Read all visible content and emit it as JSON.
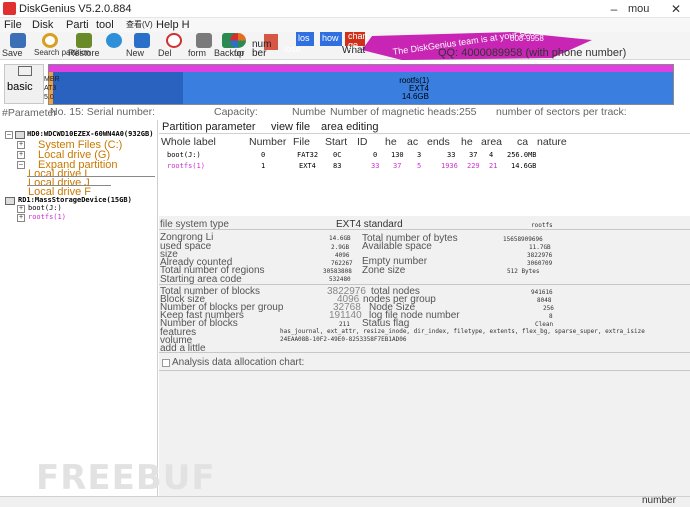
{
  "window": {
    "title": "DiskGenius V5.2.0.884",
    "corner_text": "mou",
    "minimize": "–",
    "maximize": "□",
    "close": "✕"
  },
  "menu": {
    "items": [
      {
        "label": "File"
      },
      {
        "label": "Disk"
      },
      {
        "label": "Parti"
      },
      {
        "label": "tool"
      },
      {
        "label": "查看(V)"
      },
      {
        "label": "Help H"
      }
    ]
  },
  "toolbar": {
    "buttons": [
      {
        "label": "Save",
        "icon": "save-icon",
        "color": "#3b6fb6"
      },
      {
        "label": "Search partition",
        "icon": "search-icon",
        "color": "#d8a020"
      },
      {
        "label": "Restore",
        "icon": "restore-icon",
        "color": "#6a8a2a"
      },
      {
        "label": "",
        "icon": "globe-icon",
        "color": "#2f8fd8"
      },
      {
        "label": "New",
        "icon": "new-icon",
        "color": "#2a70c8"
      },
      {
        "label": "Del",
        "icon": "delete-icon",
        "color": "#d03030"
      },
      {
        "label": "form",
        "icon": "format-icon",
        "color": "#7a7a7a"
      },
      {
        "label": "Backup",
        "icon": "backup-icon",
        "color": "#2a8a50"
      },
      {
        "label": "for",
        "icon": "pie-icon",
        "color": "#e07020"
      }
    ],
    "banner_words": [
      "num",
      "ber",
      "lose",
      "los",
      "how",
      "What",
      "chan",
      "ge"
    ],
    "banner_tagline": "The DiskGenius team is at your service",
    "banner_phone": "008-9958",
    "qq_label": "QQ: 4000089958 (with phone number)"
  },
  "disk_map": {
    "basic_label": "basic",
    "partition_name": "rootfs(1)",
    "partition_fs": "EXT4",
    "partition_size": "14.6GB",
    "left_fragments": [
      "MBR",
      "AT3",
      "5.0"
    ]
  },
  "info_line": {
    "prefix": "#Parameter",
    "text": "No. 15: Serial number:",
    "capacity": "Capacity:",
    "number": "Numbe",
    "heads": "Number of magnetic heads:255",
    "sectors": "number of sectors per track:"
  },
  "tree": {
    "disk0": "HD0:WDCWD10EZEX-60WN4A0(932GB)",
    "disk0_children": [
      "System Files (C:)",
      "Local drive (G)",
      "Expand partition"
    ],
    "extended_children": [
      "Local drive I",
      "Local drive J",
      "Local drive F"
    ],
    "disk1": "RD1:MassStorageDevice(15GB)",
    "disk1_children": [
      "boot(J:)",
      "rootfs(1)"
    ]
  },
  "tabs": {
    "params": "Partition parameter",
    "view": "view file",
    "edit": "area editing"
  },
  "partition_table": {
    "headers": [
      "Whole label",
      "Number",
      "File",
      "Start",
      "ID",
      "he",
      "ac",
      "ends",
      "he",
      "area",
      "ca",
      "nature"
    ],
    "rows": [
      {
        "name": "boot(J:)",
        "num": "0",
        "fs": "FAT32",
        "id": "0C",
        "c1": "0",
        "h1": "130",
        "s1": "3",
        "c2": "33",
        "h2": "37",
        "s2": "4",
        "cap": "256.0MB"
      },
      {
        "name": "rootfs(1)",
        "num": "1",
        "fs": "EXT4",
        "id": "83",
        "c1": "33",
        "h1": "37",
        "s1": "5",
        "c2": "1936",
        "h2": "229",
        "s2": "21",
        "cap": "14.6GB"
      }
    ]
  },
  "details": {
    "fs_type_label": "file system type",
    "fs_type_value": "EXT4 standard",
    "fs_type_tag": "rootfs",
    "left": [
      {
        "label": "Zongrong Li",
        "value": "14.6GB"
      },
      {
        "label": "used space",
        "value": "2.9GB"
      },
      {
        "label": "size",
        "value": "4096"
      },
      {
        "label": "Already counted",
        "value": "762267"
      },
      {
        "label": "Total number of regions",
        "value": "30583808"
      },
      {
        "label": "Starting area code",
        "value": "532480"
      }
    ],
    "right": [
      {
        "label": "Total number of bytes",
        "value": "15658909696"
      },
      {
        "label": "Available space",
        "value": "11.7GB"
      },
      {
        "label": "",
        "value": "3822976"
      },
      {
        "label": "Empty number",
        "value": "3060709"
      },
      {
        "label": "Zone size",
        "value": "512 Bytes"
      }
    ],
    "block_left": [
      {
        "label": "Total number of blocks",
        "value": "3822976"
      },
      {
        "label": "Block size",
        "value": "4096"
      },
      {
        "label": "Number of blocks per group",
        "value": "32768"
      },
      {
        "label": "Keep fast numbers",
        "value": "191140"
      },
      {
        "label": "Number of blocks",
        "value": "211"
      }
    ],
    "block_right": [
      {
        "label": "total nodes",
        "value": "941616"
      },
      {
        "label": "nodes per group",
        "value": "8048"
      },
      {
        "label": "Node Size",
        "value": "256"
      },
      {
        "label": "log file node number",
        "value": "8"
      },
      {
        "label": "Status flag",
        "value": "Clean"
      }
    ],
    "features_label": "features",
    "features_value": "has_journal, ext_attr, resize_inode, dir_index, filetype, extents, flex_bg, sparse_super, extra_isize",
    "volume_label": "volume",
    "volume_value": "24EAA08B-10F2-49E0-8253358F7EB1AD06",
    "add_label": "add a little",
    "analyze_label": "Analysis data allocation chart:"
  },
  "status": {
    "right_text": "number"
  },
  "watermark": "FREEBUF",
  "colors": {
    "partition_blue": "#3a7fe0",
    "partition_magenta": "#e040e0",
    "tree_orange": "#c87800",
    "tree_magenta": "#d030d0"
  }
}
